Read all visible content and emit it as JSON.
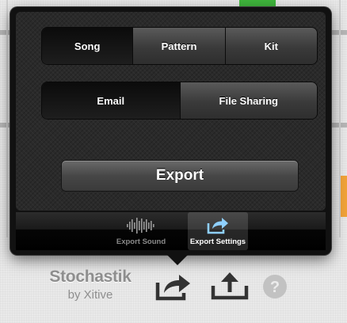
{
  "segments_content": [
    {
      "label": "Song",
      "selected": true
    },
    {
      "label": "Pattern",
      "selected": false
    },
    {
      "label": "Kit",
      "selected": false
    }
  ],
  "segments_destination": [
    {
      "label": "Email",
      "selected": true
    },
    {
      "label": "File Sharing",
      "selected": false
    }
  ],
  "export_button": {
    "label": "Export"
  },
  "tabs": [
    {
      "label": "Export Sound",
      "icon": "waveform-icon",
      "active": false
    },
    {
      "label": "Export Settings",
      "icon": "share-arrow-icon",
      "active": true
    }
  ],
  "brand": {
    "name": "Stochastik",
    "by": "by Xitive"
  },
  "toolbar": {
    "icons": [
      "share-arrow-icon",
      "upload-icon",
      "help-icon"
    ]
  },
  "colors": {
    "popover_bg": "#111111",
    "selected_segment": "#0b0b0b",
    "unselected_segment": "#4a4a4a",
    "tab_active_icon": "#7fc4ff",
    "brand_gray": "#8e8e8e"
  }
}
